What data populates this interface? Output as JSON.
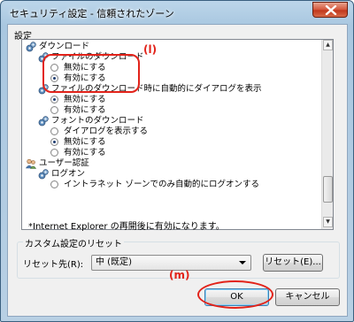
{
  "window": {
    "title": "セキュリティ設定 - 信頼されたゾーン"
  },
  "settings": {
    "heading": "設定",
    "tree": [
      {
        "kind": "category",
        "label": "ダウンロード"
      },
      {
        "kind": "setting",
        "label": "ファイルのダウンロード"
      },
      {
        "kind": "option",
        "label": "無効にする",
        "selected": false
      },
      {
        "kind": "option",
        "label": "有効にする",
        "selected": true
      },
      {
        "kind": "setting",
        "label": "ファイルのダウンロード時に自動的にダイアログを表示"
      },
      {
        "kind": "option",
        "label": "無効にする",
        "selected": true
      },
      {
        "kind": "option",
        "label": "有効にする",
        "selected": false
      },
      {
        "kind": "setting",
        "label": "フォントのダウンロード"
      },
      {
        "kind": "option",
        "label": "ダイアログを表示する",
        "selected": false
      },
      {
        "kind": "option",
        "label": "無効にする",
        "selected": true
      },
      {
        "kind": "option",
        "label": "有効にする",
        "selected": false
      },
      {
        "kind": "category",
        "label": "ユーザー認証"
      },
      {
        "kind": "setting",
        "label": "ログオン"
      },
      {
        "kind": "option",
        "label": "イントラネット ゾーンでのみ自動的にログオンする",
        "selected": false
      }
    ],
    "restart_note": "*Internet Explorer の再開後に有効になります。"
  },
  "reset": {
    "group_title": "カスタム設定のリセット",
    "reset_to_label": "リセット先(R):",
    "selected_level": "中 (既定)",
    "reset_button": "リセット(E)..."
  },
  "buttons": {
    "ok": "OK",
    "cancel": "キャンセル"
  },
  "annotations": {
    "mark_l": "(l)",
    "mark_m": "(m)",
    "color": "#e2231a"
  }
}
